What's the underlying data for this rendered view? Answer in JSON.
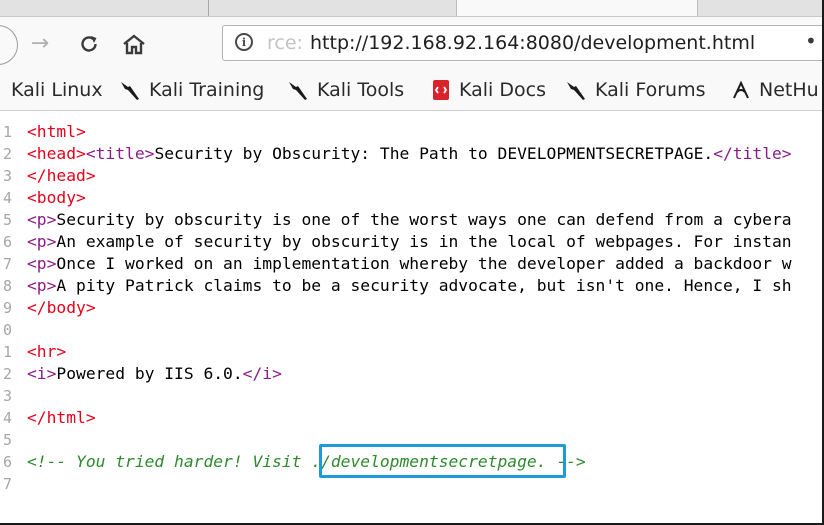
{
  "browser": {
    "url_faded_prefix": "rce:",
    "url": "http://192.168.92.164:8080/development.html",
    "more_dot": "•"
  },
  "bookmarks": [
    {
      "label": "Kali Linux",
      "icon": "none"
    },
    {
      "label": "Kali Training",
      "icon": "kali-dragon-icon"
    },
    {
      "label": "Kali Tools",
      "icon": "kali-dragon-icon"
    },
    {
      "label": "Kali Docs",
      "icon": "kali-docs-icon"
    },
    {
      "label": "Kali Forums",
      "icon": "kali-dragon-icon"
    },
    {
      "label": "NetHu",
      "icon": "nethunter-icon"
    }
  ],
  "source": {
    "lines": [
      {
        "n": "1",
        "text": "<html>"
      },
      {
        "n": "2",
        "text": "<head><title>Security by Obscurity: The Path to DEVELOPMENTSECRETPAGE.</title>"
      },
      {
        "n": "3",
        "text": "</head>"
      },
      {
        "n": "4",
        "text": "<body>"
      },
      {
        "n": "5",
        "text": "<p>Security by obscurity is one of the worst ways one can defend from a cybera"
      },
      {
        "n": "6",
        "text": "<p>An example of security by obscurity is in the local of webpages. For instan"
      },
      {
        "n": "7",
        "text": "<p>Once I worked on an implementation whereby the developer added a backdoor w"
      },
      {
        "n": "8",
        "text": "<p>A pity Patrick claims to be a security advocate, but isn't one. Hence, I sh"
      },
      {
        "n": "9",
        "text": "</body>"
      },
      {
        "n": "0",
        "text": ""
      },
      {
        "n": "1",
        "text": "<hr>"
      },
      {
        "n": "2",
        "text": "<i>Powered by IIS 6.0.</i>"
      },
      {
        "n": "3",
        "text": ""
      },
      {
        "n": "4",
        "text": "</html>"
      },
      {
        "n": "5",
        "text": ""
      },
      {
        "n": "6",
        "text": "<!-- You tried harder! Visit ./developmentsecretpage. -->"
      },
      {
        "n": "7",
        "text": ""
      }
    ],
    "colors": {
      "tag_red": "#e6001a",
      "tag_purple": "#8a1b87",
      "comment": "#2d8a2d",
      "highlight": "#1e9ad8"
    }
  }
}
